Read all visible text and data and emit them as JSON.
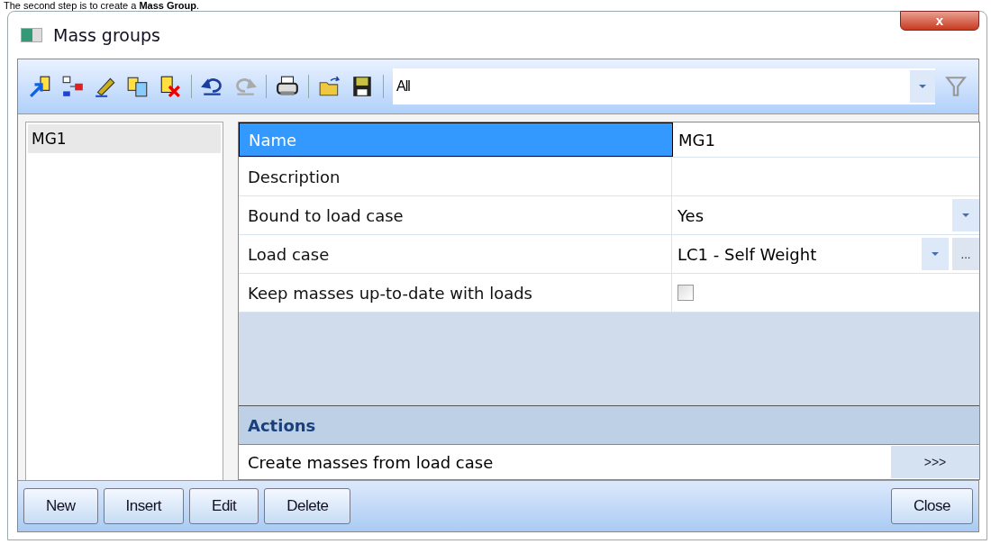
{
  "caption": "The second step is to create a **Mass Group**.",
  "window": {
    "title": "Mass groups",
    "close": "x"
  },
  "toolbar": {
    "filter": {
      "value": "All"
    }
  },
  "list": [
    {
      "label": "MG1",
      "selected": true
    }
  ],
  "properties": [
    {
      "name": "Name",
      "value": "MG1",
      "kind": "text",
      "selected": true
    },
    {
      "name": "Description",
      "kind": "text",
      "selected": false
    },
    {
      "name": "Bound to load case",
      "value": "Yes",
      "kind": "dropdown",
      "selected": false
    },
    {
      "name": "Load case",
      "value": "LC1 - Self Weight",
      "kind": "dropdown_more",
      "more": "...",
      "selected": false
    },
    {
      "name": "Keep masses up-to-date with loads",
      "kind": "checkbox",
      "checked": false,
      "selected": false
    }
  ],
  "actions": {
    "title": "Actions",
    "items": [
      {
        "label": "Create masses from load case",
        "button": ">>>"
      }
    ]
  },
  "buttons": [
    {
      "label": "New"
    },
    {
      "label": "Insert"
    },
    {
      "label": "Edit"
    },
    {
      "label": "Delete"
    }
  ],
  "close_button": {
    "label": "Close"
  }
}
